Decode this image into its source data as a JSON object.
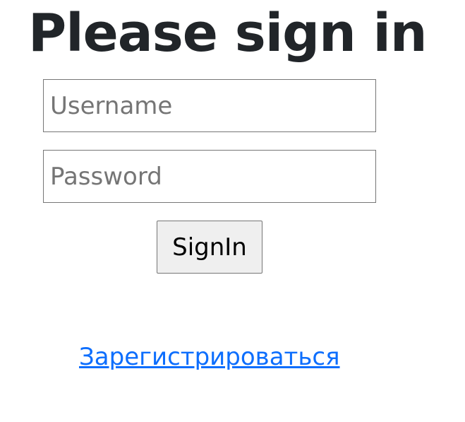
{
  "heading": {
    "title": "Please sign in"
  },
  "form": {
    "username": {
      "placeholder": "Username",
      "value": ""
    },
    "password": {
      "placeholder": "Password",
      "value": ""
    },
    "submit_label": "SignIn"
  },
  "links": {
    "register_label": "Зарегистрироваться"
  },
  "colors": {
    "heading": "#212529",
    "link": "#0d6efd",
    "button_bg": "#efefef",
    "input_border": "#767676"
  }
}
